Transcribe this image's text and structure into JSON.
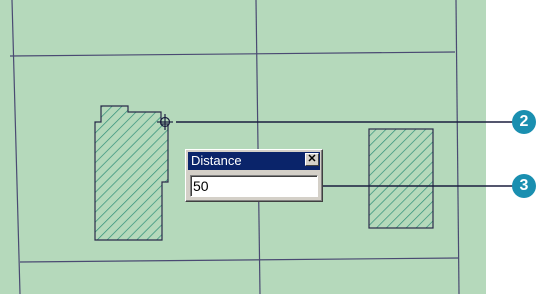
{
  "dialog": {
    "title": "Distance",
    "close_glyph": "✕",
    "value": "50"
  },
  "callouts": [
    "2",
    "3"
  ],
  "colors": {
    "parcel_fill": "#b5d9bb",
    "boundary_line": "#4a4a72",
    "hatch": "#2f8f78",
    "callout": "#1a8fb0",
    "leader_line": "#1b1f3f"
  },
  "icons": {
    "snap_cursor": "crosshair-circle-icon"
  }
}
